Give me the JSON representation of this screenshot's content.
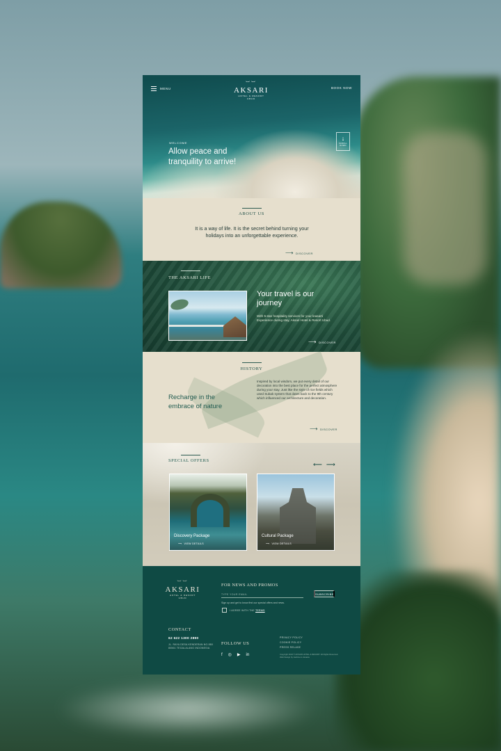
{
  "header": {
    "menu_label": "MENU",
    "logo_name": "AKSARI",
    "logo_tagline": "HOTEL & RESORT",
    "logo_sub": "UBUD",
    "book_label": "BOOK NOW"
  },
  "hero": {
    "eyebrow": "WELCOME",
    "title": "Allow peace and tranquility to arrive!",
    "scroll_label": "SCROLL DOWN"
  },
  "about": {
    "title": "ABOUT US",
    "text": "It is a way of life. It is the secret behind turning your holidays into an unforgettable experience.",
    "link": "DISCOVER"
  },
  "life": {
    "title": "THE AKSARI LIFE",
    "heading": "Your travel is our journey",
    "text": "With 5-star hospitality services for your leasarti Experience during stay, Aksari Hotel & Resort Ubud.",
    "link": "DISCOVER"
  },
  "history": {
    "title": "HISTORY",
    "heading": "Recharge in the embrace of nature",
    "text": "Inspired by local wisdom, we put every detail of our decoration into the best place for the perfect atmosphere during your stay. Just like the style of rice fields which used Subak system that dates back to the 9th century which influenced our architecture and decoration.",
    "link": "DISCOVER"
  },
  "offers": {
    "title": "SPECIAL OFFERS",
    "prev": "⟵",
    "next": "⟶",
    "items": [
      {
        "name": "Discovery Package",
        "link": "VIEW DETAILS"
      },
      {
        "name": "Cultural Package",
        "link": "VIEW DETAILS"
      }
    ]
  },
  "footer": {
    "logo_name": "AKSARI",
    "logo_tagline": "HOTEL & RESORT",
    "logo_sub": "UBUD",
    "news_title": "FOR NEWS AND PROMOS",
    "email_placeholder": "TYPE YOUR EMAIL",
    "subscribe_label": "SUBSCRIBE",
    "note": "Sign up and get to know first our special offers and news.",
    "agree_text": "I AGREE WITH THE",
    "agree_link": "TERMS",
    "contact_title": "CONTACT",
    "phone": "62 622 1300 2890",
    "address": "JL. RAYA DESA KENDERAN NO.88X 80561 TEGALALANG INDONESIA",
    "follow_title": "FOLLOW US",
    "social": [
      "f",
      "◎",
      "▶",
      "in"
    ],
    "links": [
      "PRIVACY POLICY",
      "COOKIE POLICY",
      "PRESS RELASE"
    ],
    "copyright": "Copyright 2023 © AKSARI HOTEL & RESORT. All Rights Reserved. Web Design by Jacinta.co Janavia"
  },
  "colors": {
    "deep_green": "#0f4a44",
    "sand": "#e6dfcd",
    "accent": "#1f5a4f"
  }
}
